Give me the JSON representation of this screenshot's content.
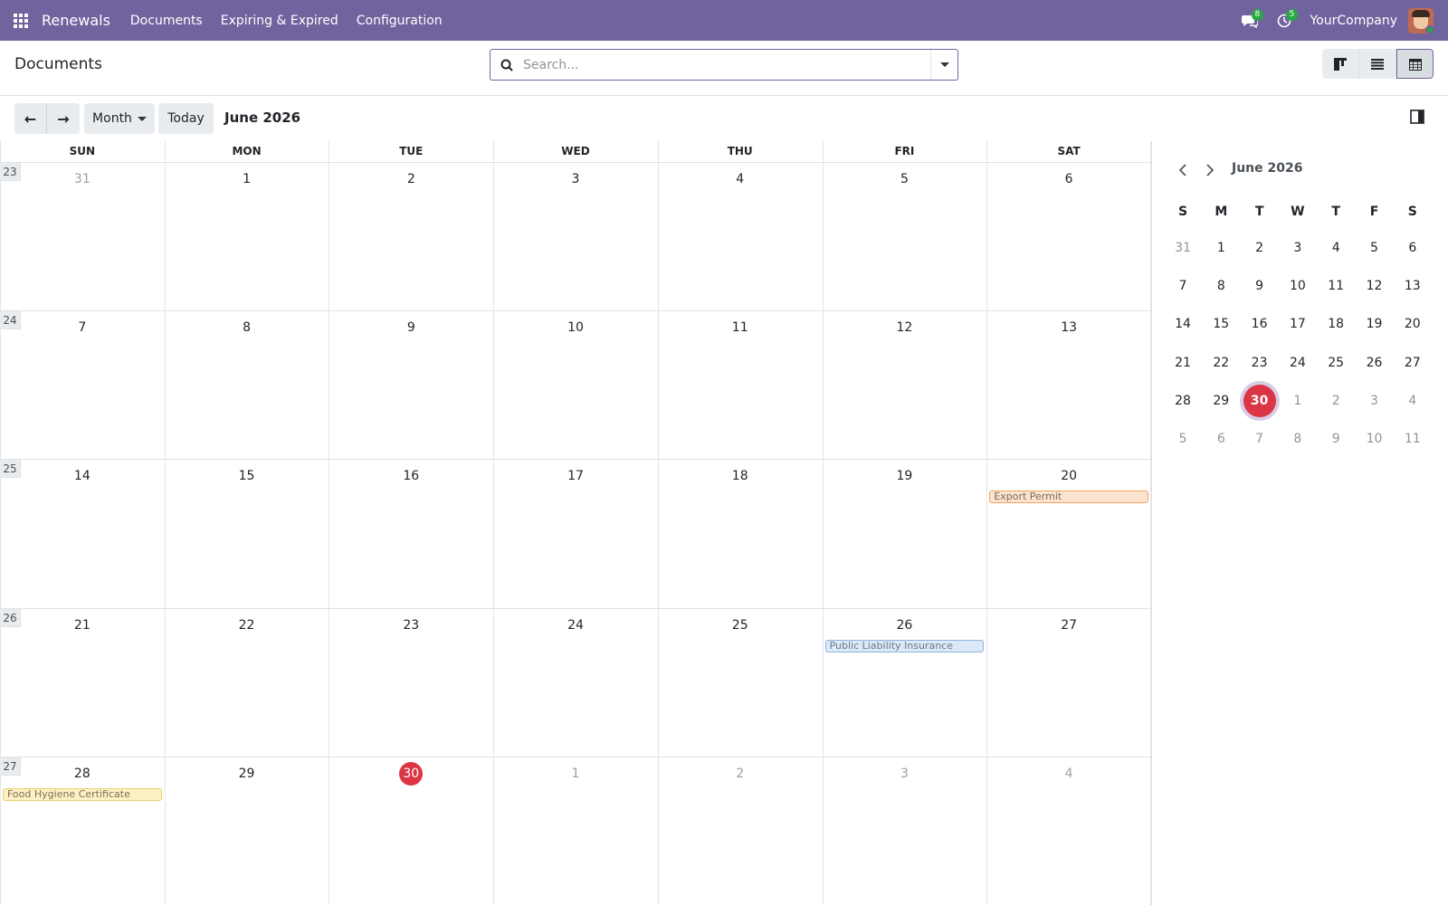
{
  "navbar": {
    "brand": "Renewals",
    "menu": [
      "Documents",
      "Expiring & Expired",
      "Configuration"
    ],
    "messages_badge": "8",
    "activities_badge": "5",
    "company": "YourCompany"
  },
  "control_panel": {
    "title": "Documents",
    "search_placeholder": "Search..."
  },
  "toolbar": {
    "scale_label": "Month",
    "today_label": "Today",
    "period": "June 2026"
  },
  "calendar": {
    "weekdays": [
      "SUN",
      "MON",
      "TUE",
      "WED",
      "THU",
      "FRI",
      "SAT"
    ],
    "weeks": [
      {
        "num": "23",
        "days": [
          "31",
          "1",
          "2",
          "3",
          "4",
          "5",
          "6"
        ]
      },
      {
        "num": "24",
        "days": [
          "7",
          "8",
          "9",
          "10",
          "11",
          "12",
          "13"
        ]
      },
      {
        "num": "25",
        "days": [
          "14",
          "15",
          "16",
          "17",
          "18",
          "19",
          "20"
        ]
      },
      {
        "num": "26",
        "days": [
          "21",
          "22",
          "23",
          "24",
          "25",
          "26",
          "27"
        ]
      },
      {
        "num": "27",
        "days": [
          "28",
          "29",
          "30",
          "1",
          "2",
          "3",
          "4"
        ]
      }
    ],
    "events": [
      {
        "title": "Export Permit",
        "week": 2,
        "day": 6,
        "color": "#fbe4cf"
      },
      {
        "title": "Public Liability Insurance",
        "week": 3,
        "day": 5,
        "color": "#dbe9f8"
      },
      {
        "title": "Food Hygiene Certificate",
        "week": 4,
        "day": 0,
        "color": "#fdf1c4"
      }
    ],
    "today": "30",
    "today_color": "#dc3545"
  },
  "mini_calendar": {
    "title": "June 2026",
    "weekdays": [
      "S",
      "M",
      "T",
      "W",
      "T",
      "F",
      "S"
    ],
    "weeks": [
      [
        "31",
        "1",
        "2",
        "3",
        "4",
        "5",
        "6"
      ],
      [
        "7",
        "8",
        "9",
        "10",
        "11",
        "12",
        "13"
      ],
      [
        "14",
        "15",
        "16",
        "17",
        "18",
        "19",
        "20"
      ],
      [
        "21",
        "22",
        "23",
        "24",
        "25",
        "26",
        "27"
      ],
      [
        "28",
        "29",
        "30",
        "1",
        "2",
        "3",
        "4"
      ],
      [
        "5",
        "6",
        "7",
        "8",
        "9",
        "10",
        "11"
      ]
    ]
  },
  "colors": {
    "navbar": "#71639e",
    "accent": "#71639e",
    "today": "#dc3545"
  }
}
